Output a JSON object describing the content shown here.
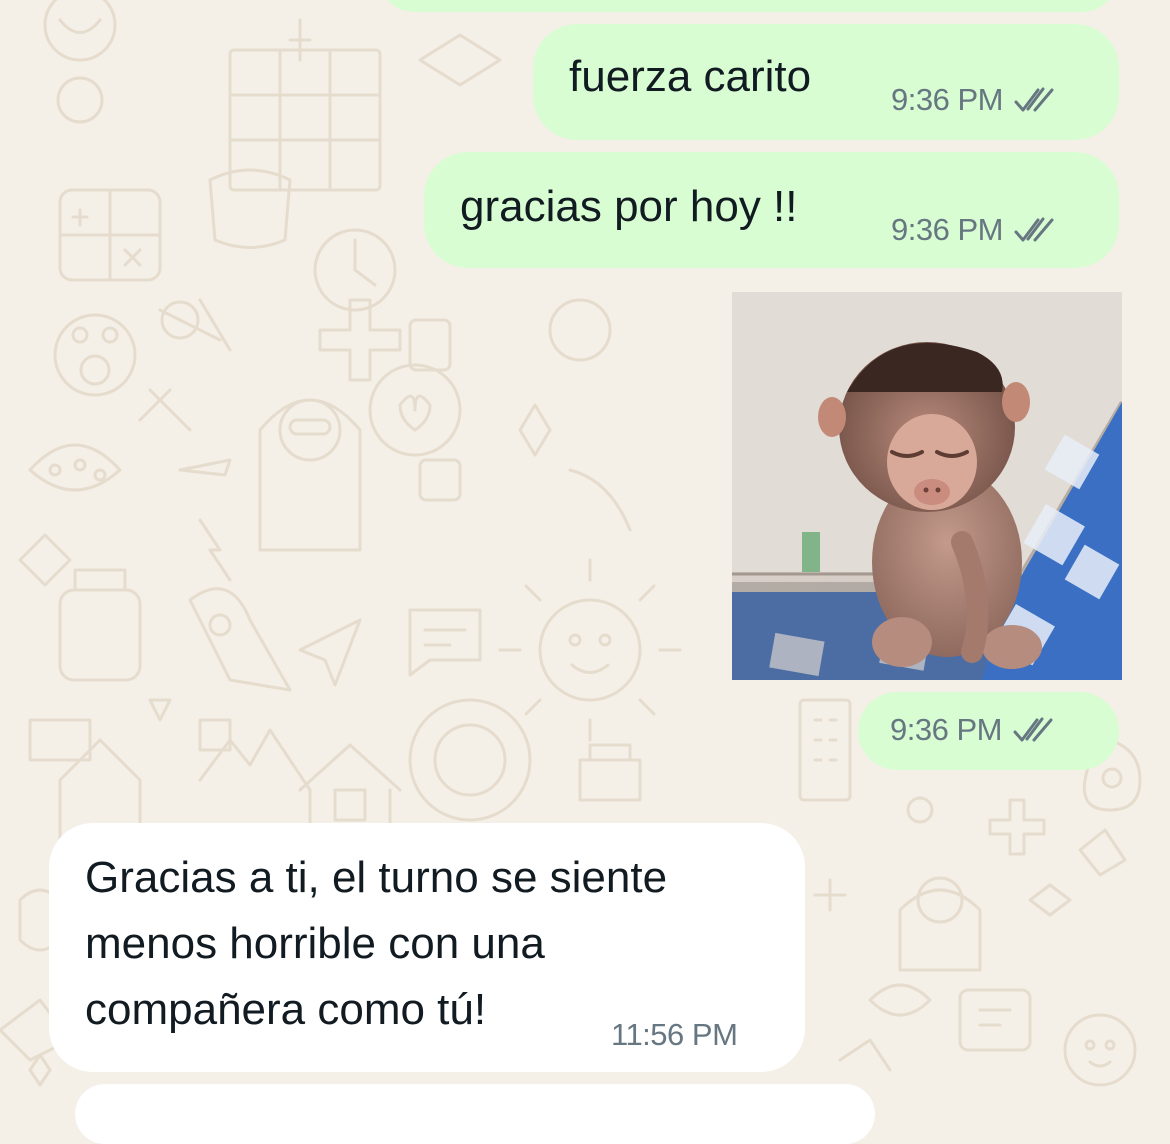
{
  "wallpaper": {
    "background": "#f4efe7",
    "doodle_color": "#e6dccd"
  },
  "colors": {
    "outgoing_bubble": "#d9fdd3",
    "incoming_bubble": "#ffffff",
    "text": "#111b21",
    "meta": "#667781",
    "read_ticks": "#667781"
  },
  "messages": [
    {
      "direction": "outgoing",
      "type": "text",
      "text": "fuerza carito",
      "time": "9:36 PM",
      "status_icon": "double-check-icon"
    },
    {
      "direction": "outgoing",
      "type": "text",
      "text": "gracias por hoy !!",
      "time": "9:36 PM",
      "status_icon": "double-check-icon"
    },
    {
      "direction": "outgoing",
      "type": "sticker",
      "sticker": "sleepy-baby-monkey-sticker",
      "time": "9:36 PM",
      "status_icon": "double-check-icon"
    },
    {
      "direction": "incoming",
      "type": "text",
      "lines": [
        "Gracias a ti, el turno se siente",
        "menos horrible con una",
        "compañera como tú!"
      ],
      "time": "11:56 PM"
    }
  ]
}
